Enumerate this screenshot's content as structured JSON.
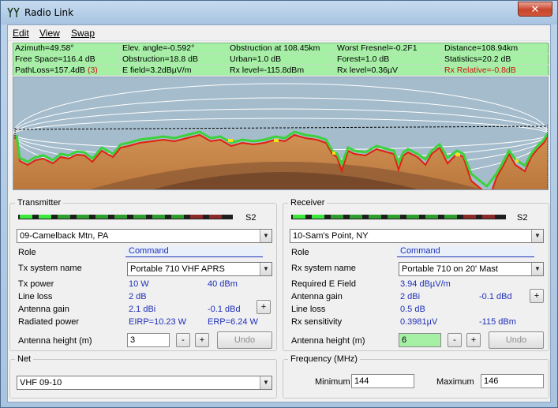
{
  "window": {
    "title": "Radio Link",
    "close_glyph": "✕"
  },
  "menu": [
    "Edit",
    "View",
    "Swap"
  ],
  "stats": [
    [
      "Azimuth=49.58°",
      "Elev. angle=-0.592°",
      "Obstruction at 108.45km",
      "Worst Fresnel=-0.2F1",
      "Distance=108.94km"
    ],
    [
      "Free Space=116.4 dB",
      "Obstruction=18.8 dB",
      "Urban=1.0 dB",
      "Forest=1.0 dB",
      "Statistics=20.2 dB"
    ],
    [
      "PathLoss=157.4dB",
      "E field=3.2dBµV/m",
      "Rx level=-115.8dBm",
      "Rx level=0.36µV",
      "Rx Relative=-0.8dB"
    ]
  ],
  "pathloss_flag": "(3)",
  "colors": {
    "stats_bg": "#a6f0a6",
    "red": "#d01010",
    "link_blue": "#1f2fb7",
    "profile_sky": "#a4bccc",
    "terrain": "#c8864a",
    "terrain_dark": "#7a4a2c"
  },
  "transmitter": {
    "group_label": "Transmitter",
    "signal_label": "S2",
    "site": "09-Camelback Mtn, PA",
    "role_label": "Role",
    "role_value": "Command",
    "system_label": "Tx system name",
    "system_value": "Portable 710 VHF APRS",
    "power_label": "Tx power",
    "power_w": "10 W",
    "power_dbm": "40 dBm",
    "line_loss_label": "Line loss",
    "line_loss": "2 dB",
    "antenna_gain_label": "Antenna gain",
    "gain_dbi": "2.1 dBi",
    "gain_dbd": "-0.1 dBd",
    "radiated_label": "Radiated power",
    "eirp": "EIRP=10.23 W",
    "erp": "ERP=6.24 W",
    "height_label": "Antenna height (m)",
    "height_value": "3",
    "minus": "-",
    "plus": "+",
    "undo": "Undo"
  },
  "receiver": {
    "group_label": "Receiver",
    "signal_label": "S2",
    "site": "10-Sam's Point, NY",
    "role_label": "Role",
    "role_value": "Command",
    "system_label": "Rx system name",
    "system_value": "Portable 710 on 20' Mast",
    "required_label": "Required E Field",
    "required_value": "3.94 dBµV/m",
    "antenna_gain_label": "Antenna gain",
    "gain_dbi": "2 dBi",
    "gain_dbd": "-0.1 dBd",
    "line_loss_label": "Line loss",
    "line_loss": "0.5 dB",
    "sensitivity_label": "Rx sensitivity",
    "sens_uv": "0.3981µV",
    "sens_dbm": "-115 dBm",
    "height_label": "Antenna height (m)",
    "height_value": "6",
    "minus": "-",
    "plus": "+",
    "undo": "Undo"
  },
  "net": {
    "group_label": "Net",
    "value": "VHF 09-10"
  },
  "frequency": {
    "group_label": "Frequency (MHz)",
    "min_label": "Minimum",
    "min_value": "144",
    "max_label": "Maximum",
    "max_value": "146"
  }
}
